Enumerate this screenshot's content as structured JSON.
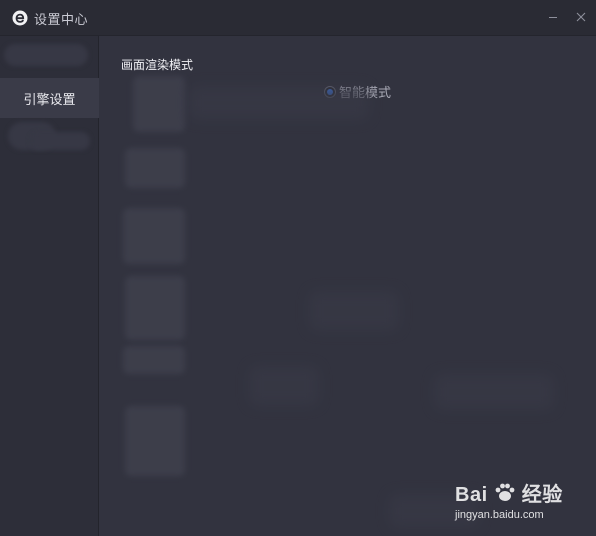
{
  "window": {
    "title": "设置中心",
    "minimize_icon": "minimize-icon",
    "close_icon": "close-icon",
    "logo_icon": "app-e-logo-icon"
  },
  "sidebar": {
    "items": [
      {
        "label": "引擎设置",
        "active": true
      }
    ]
  },
  "main": {
    "section_label": "画面渲染模式",
    "render_mode": {
      "selected_label": "智能模式",
      "selected": true
    }
  },
  "colors": {
    "accent": "#3d78e6",
    "window_bg": "#2d2e39",
    "content_bg": "#32333f"
  },
  "watermark": {
    "brand_left": "Bai",
    "brand_right": "经验",
    "url": "jingyan.baidu.com"
  }
}
